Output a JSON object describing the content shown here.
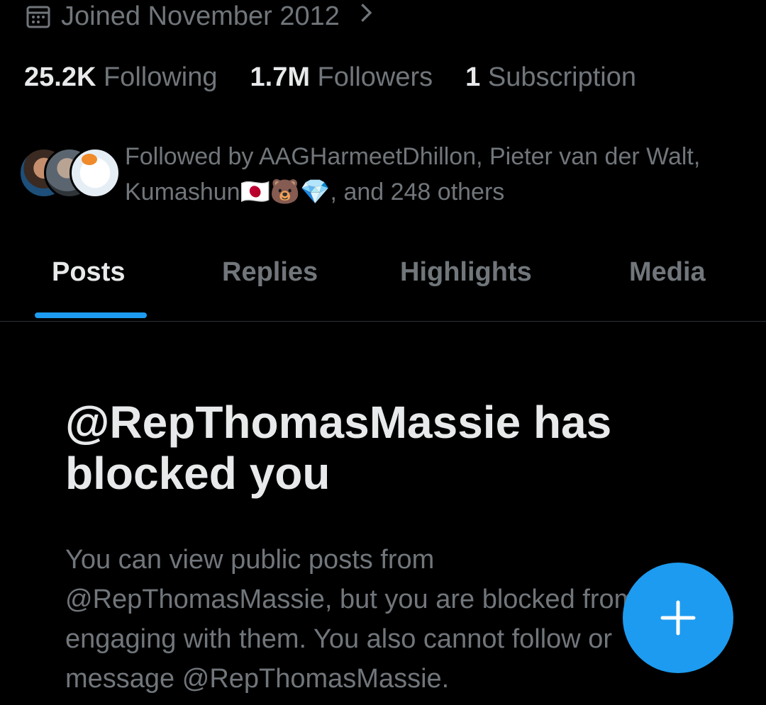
{
  "profile": {
    "joined": "Joined November 2012",
    "stats": [
      {
        "value": "25.2K",
        "label": "Following"
      },
      {
        "value": "1.7M",
        "label": "Followers"
      },
      {
        "value": "1",
        "label": "Subscription"
      }
    ],
    "followed_by": "Followed by AAGHarmeetDhillon, Pieter van der Walt, Kumashun🇯🇵🐻💎, and 248 others"
  },
  "tabs": [
    {
      "label": "Posts",
      "active": true
    },
    {
      "label": "Replies",
      "active": false
    },
    {
      "label": "Highlights",
      "active": false
    },
    {
      "label": "Media",
      "active": false
    }
  ],
  "blocked": {
    "title": "@RepThomasMassie has blocked you",
    "description": "You can view public posts from @RepThomasMassie, but you are blocked from engaging with them. You also cannot follow or message @RepThomasMassie."
  },
  "icons": {
    "calendar": "calendar-icon",
    "chevron": "chevron-right-icon",
    "compose": "plus-icon"
  },
  "colors": {
    "accent": "#1d9bf0",
    "background": "#000000",
    "muted_text": "#71767b",
    "primary_text": "#e7e9ea"
  }
}
